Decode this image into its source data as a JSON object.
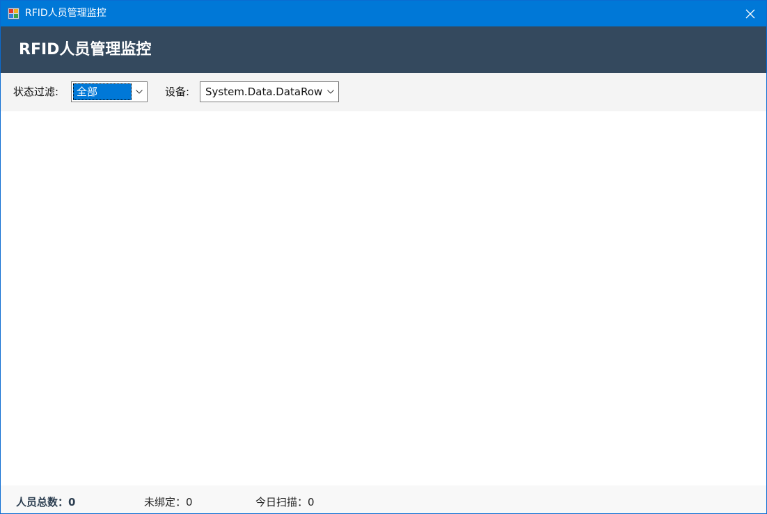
{
  "window": {
    "title": "RFID人员管理监控",
    "icons": {
      "app": "app-icon",
      "close": "close-icon"
    },
    "colors": {
      "titlebar": "#0078d7",
      "header": "#34495e"
    }
  },
  "header": {
    "title": "RFID人员管理监控"
  },
  "filters": {
    "status_label": "状态过滤:",
    "status_value": "全部",
    "device_label": "设备:",
    "device_value": "System.Data.DataRow"
  },
  "status_bar": {
    "total": "人员总数：0",
    "unbound": "未绑定：0",
    "today_scans": "今日扫描：0"
  }
}
